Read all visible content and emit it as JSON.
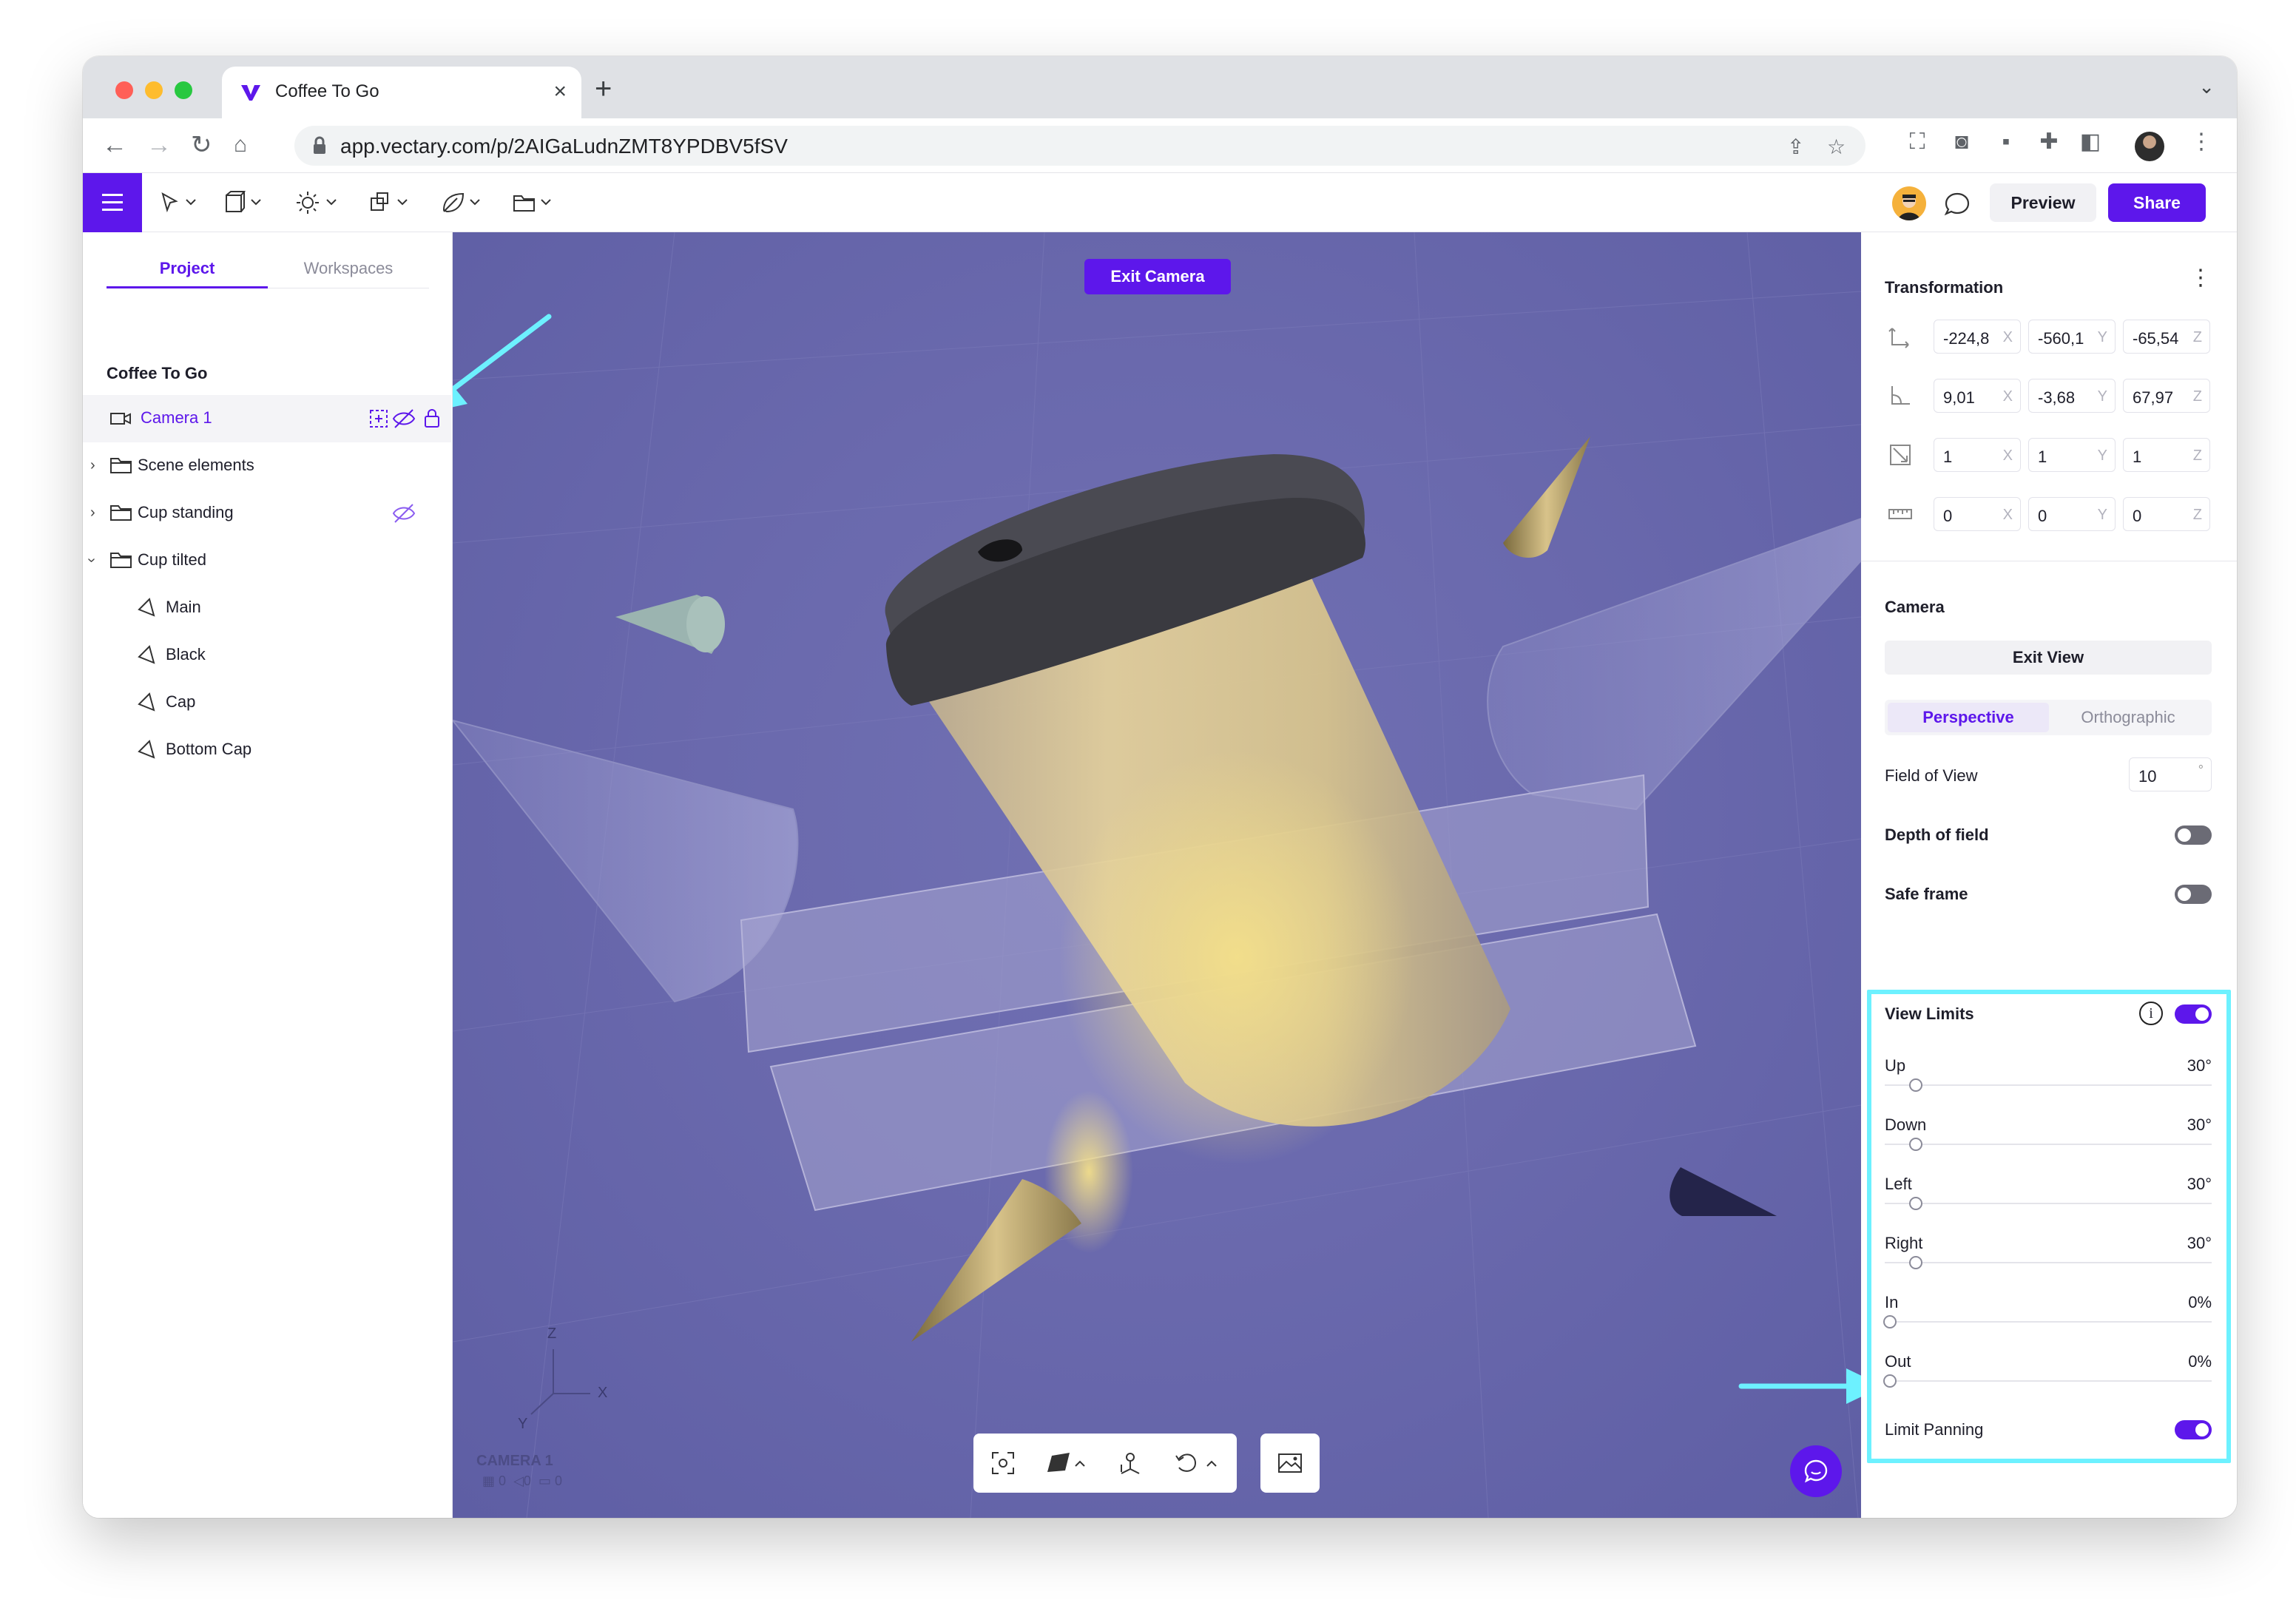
{
  "browser": {
    "tab_title": "Coffee To Go",
    "tab_close": "×",
    "new_tab": "+",
    "url": "app.vectary.com/p/2AIGaLudnZMT8YPDBV5fSV"
  },
  "toolbar": {
    "preview_label": "Preview",
    "share_label": "Share"
  },
  "left_panel": {
    "tabs": [
      "Project",
      "Workspaces"
    ],
    "project_name": "Coffee To Go",
    "tree": [
      {
        "label": "Camera 1",
        "type": "camera",
        "selected": true
      },
      {
        "label": "Scene elements",
        "type": "folder"
      },
      {
        "label": "Cup standing",
        "type": "folder"
      },
      {
        "label": "Cup tilted",
        "type": "folder",
        "expanded": true
      },
      {
        "label": "Main",
        "type": "object"
      },
      {
        "label": "Black",
        "type": "object"
      },
      {
        "label": "Cap",
        "type": "object"
      },
      {
        "label": "Bottom Cap",
        "type": "object"
      }
    ]
  },
  "viewport": {
    "exit_camera_label": "Exit Camera",
    "camera_name": "CAMERA 1",
    "stats": [
      "0",
      "0",
      "0"
    ],
    "axes": {
      "z": "Z",
      "y": "Y",
      "x": "X"
    }
  },
  "right_panel": {
    "transformation_title": "Transformation",
    "position": {
      "x": "-224,8",
      "y": "-560,1",
      "z": "-65,54"
    },
    "rotation": {
      "x": "9,01",
      "y": "-3,68",
      "z": "67,97"
    },
    "scale": {
      "x": "1",
      "y": "1",
      "z": "1"
    },
    "dimensions": {
      "x": "0",
      "y": "0",
      "z": "0"
    },
    "axis_labels": {
      "x": "X",
      "y": "Y",
      "z": "Z"
    },
    "camera_title": "Camera",
    "exit_view_label": "Exit View",
    "projection": {
      "perspective": "Perspective",
      "orthographic": "Orthographic",
      "selected": "Perspective"
    },
    "fov_label": "Field of View",
    "fov_value": "10",
    "fov_unit": "°",
    "depth_of_field_label": "Depth of field",
    "depth_of_field_on": false,
    "safe_frame_label": "Safe frame",
    "safe_frame_on": false,
    "view_limits_label": "View Limits",
    "view_limits_on": true,
    "limits": [
      {
        "label": "Up",
        "value": "30°",
        "level": 0.08
      },
      {
        "label": "Down",
        "value": "30°",
        "level": 0.08
      },
      {
        "label": "Left",
        "value": "30°",
        "level": 0.08
      },
      {
        "label": "Right",
        "value": "30°",
        "level": 0.08
      },
      {
        "label": "In",
        "value": "0%",
        "level": 0
      },
      {
        "label": "Out",
        "value": "0%",
        "level": 0
      }
    ],
    "limit_panning_label": "Limit Panning",
    "limit_panning_on": true
  },
  "colors": {
    "accent": "#5d17eb",
    "highlight": "#6df1ff",
    "viewport": "#6a69ad"
  }
}
